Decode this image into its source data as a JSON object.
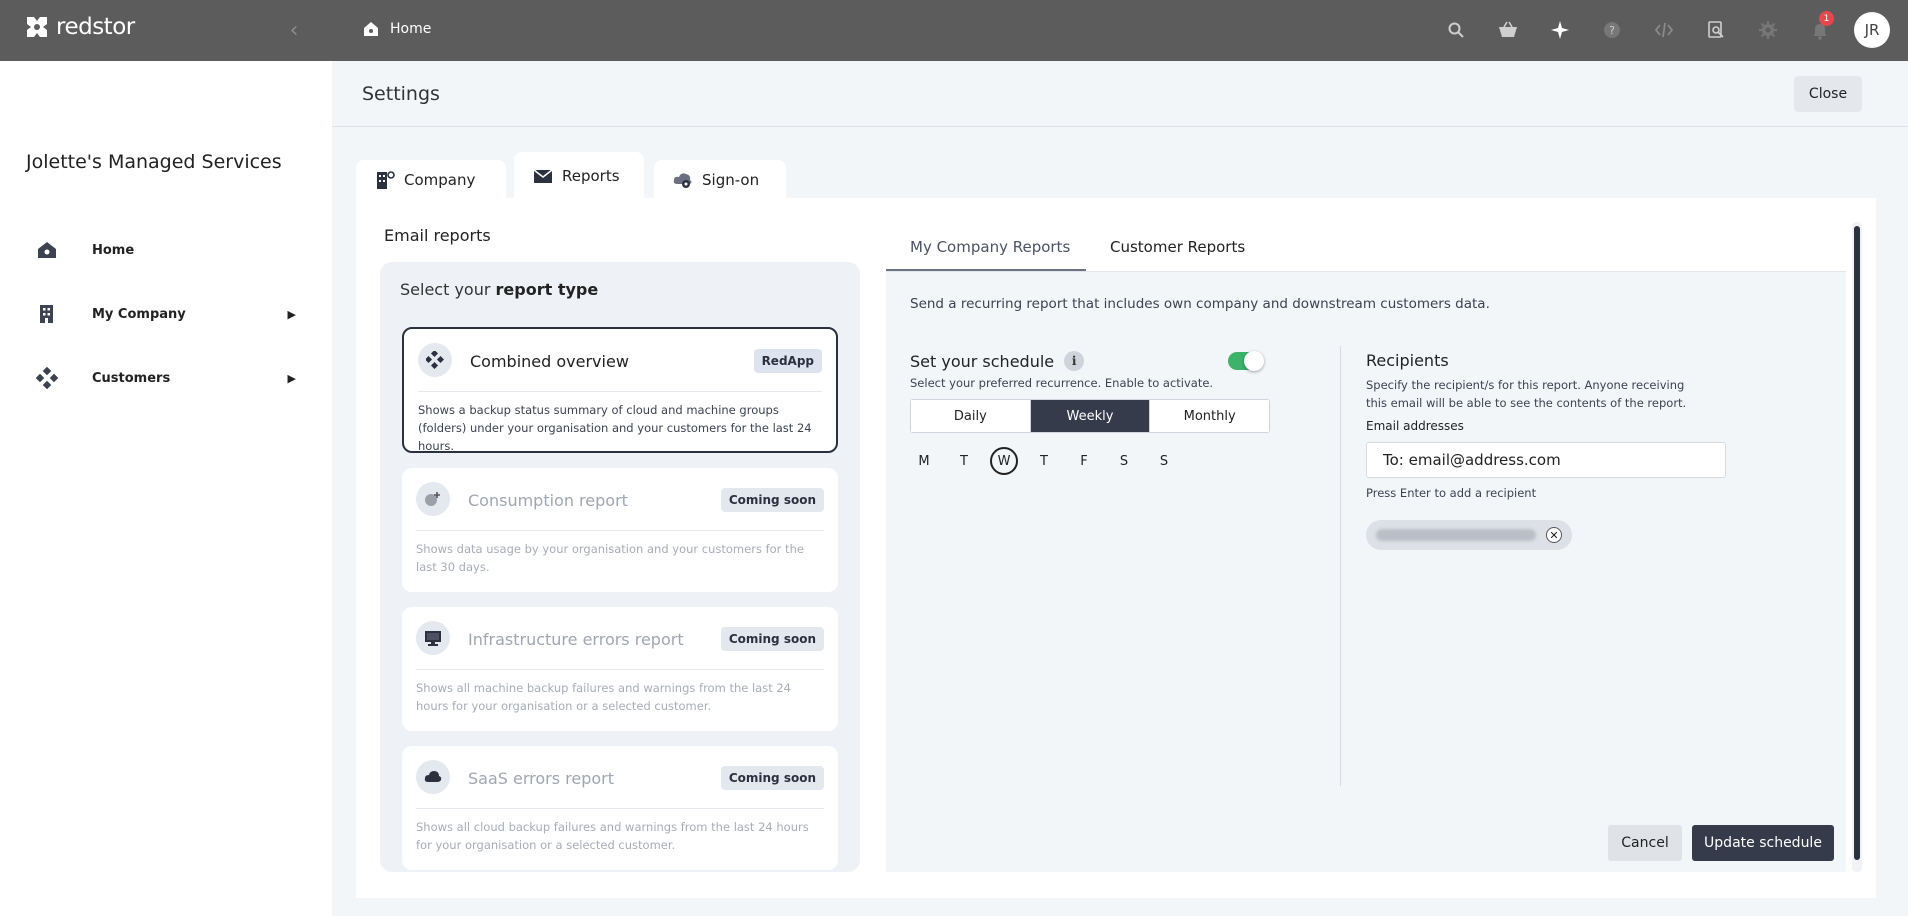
{
  "brand": {
    "name": "redstor"
  },
  "breadcrumb": {
    "label": "Home"
  },
  "topbar": {
    "icons": [
      "search-icon",
      "basket-icon",
      "sparkle-icon",
      "help-icon",
      "code-icon",
      "inspect-icon",
      "settings-icon",
      "bell-icon"
    ],
    "notification_count": "1",
    "avatar_initials": "JR"
  },
  "sidebar": {
    "org_name": "Jolette's Managed Services",
    "items": [
      {
        "label": "Home",
        "icon": "home-icon"
      },
      {
        "label": "My Company",
        "icon": "building-icon"
      },
      {
        "label": "Customers",
        "icon": "customers-icon"
      }
    ]
  },
  "page": {
    "title": "Settings",
    "close_label": "Close"
  },
  "tabs": [
    {
      "label": "Company",
      "icon": "company-icon"
    },
    {
      "label": "Reports",
      "icon": "envelope-icon",
      "active": true
    },
    {
      "label": "Sign-on",
      "icon": "sign-on-icon"
    }
  ],
  "email_reports": {
    "section_title": "Email reports",
    "type_heading_prefix": "Select your",
    "type_heading_bold": "report type",
    "cards": [
      {
        "title": "Combined overview",
        "badge": "RedApp",
        "desc": "Shows a backup status summary of cloud and machine groups (folders) under your organisation and your customers for the last 24 hours.",
        "icon": "combined-icon"
      },
      {
        "title": "Consumption report",
        "badge": "Coming soon",
        "desc": "Shows data usage by your organisation and your customers for the last 30 days.",
        "icon": "consumption-icon"
      },
      {
        "title": "Infrastructure errors report",
        "badge": "Coming soon",
        "desc": "Shows all machine backup failures and warnings from the last 24 hours for your organisation or a selected customer.",
        "icon": "monitor-icon"
      },
      {
        "title": "SaaS errors report",
        "badge": "Coming soon",
        "desc": "Shows all cloud backup failures and warnings from the last 24 hours for your organisation or a selected customer.",
        "icon": "cloud-icon"
      }
    ]
  },
  "config": {
    "tabs": [
      "My Company Reports",
      "Customer Reports"
    ],
    "description": "Send a recurring report that includes own company and downstream customers data.",
    "schedule": {
      "title": "Set your schedule",
      "info": "i",
      "subtitle": "Select your preferred recurrence. Enable to activate.",
      "enabled": true,
      "recurrence": [
        "Daily",
        "Weekly",
        "Monthly"
      ],
      "selected_recurrence": "Weekly",
      "days": [
        "M",
        "T",
        "W",
        "T",
        "F",
        "S",
        "S"
      ],
      "selected_day_index": 2
    },
    "recipients": {
      "title": "Recipients",
      "subtitle": "Specify the recipient/s for this report. Anyone receiving this email will be able to see the contents of the report.",
      "email_label": "Email addresses",
      "email_placeholder": "To: email@address.com",
      "hint": "Press Enter to add a recipient"
    },
    "cancel_label": "Cancel",
    "update_label": "Update schedule"
  }
}
